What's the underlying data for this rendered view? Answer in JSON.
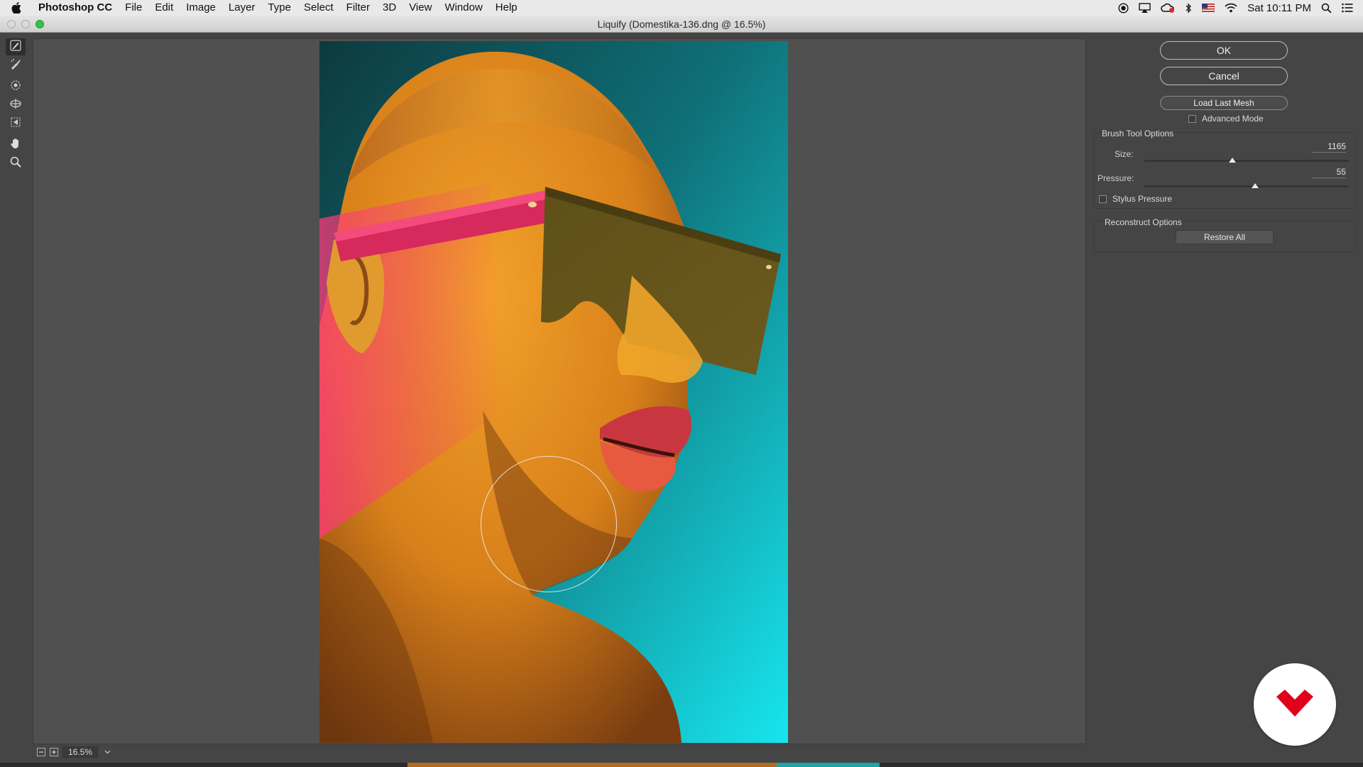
{
  "menubar": {
    "app_name": "Photoshop CC",
    "items": [
      "File",
      "Edit",
      "Image",
      "Layer",
      "Type",
      "Select",
      "Filter",
      "3D",
      "View",
      "Window",
      "Help"
    ],
    "clock": "Sat 10:11 PM",
    "status_icons": [
      "record-icon",
      "airplay-icon",
      "creative-cloud-icon",
      "bluetooth-icon",
      "flag-icon",
      "wifi-icon",
      "spotlight-icon",
      "notification-center-icon"
    ]
  },
  "window": {
    "title": "Liquify (Domestika-136.dng @ 16.5%)",
    "traffic_lights": {
      "close": "#d9d9d9",
      "minimize": "#d9d9d9",
      "zoom": "#2ec44a"
    }
  },
  "tools": [
    {
      "name": "forward-warp-tool",
      "icon": "warp-brush-icon",
      "active": true
    },
    {
      "name": "reconstruct-tool",
      "icon": "reconstruct-brush-icon",
      "active": false
    },
    {
      "name": "pucker-tool",
      "icon": "pucker-icon",
      "active": false
    },
    {
      "name": "bloat-tool",
      "icon": "bloat-icon",
      "active": false
    },
    {
      "name": "push-left-tool",
      "icon": "push-left-icon",
      "active": false
    },
    {
      "name": "hand-tool",
      "icon": "hand-icon",
      "active": false
    },
    {
      "name": "zoom-tool",
      "icon": "zoom-icon",
      "active": false
    }
  ],
  "status": {
    "zoom": "16.5%"
  },
  "panel": {
    "ok_label": "OK",
    "cancel_label": "Cancel",
    "load_mesh_label": "Load Last Mesh",
    "advanced_mode_label": "Advanced Mode",
    "advanced_mode_checked": false,
    "brush": {
      "title": "Brush Tool Options",
      "size_label": "Size:",
      "size_value": "1165",
      "size_fraction": 0.43,
      "pressure_label": "Pressure:",
      "pressure_value": "55",
      "pressure_fraction": 0.54,
      "stylus_label": "Stylus Pressure",
      "stylus_checked": false
    },
    "reconstruct": {
      "title": "Reconstruct Options",
      "restore_label": "Restore All"
    }
  },
  "colors": {
    "accent_orange": "#e8a21c",
    "accent_teal": "#14b9c2",
    "accent_magenta": "#d0285a",
    "badge_red": "#e2001a"
  },
  "badge": {
    "icon": "domestika-logo-icon"
  }
}
